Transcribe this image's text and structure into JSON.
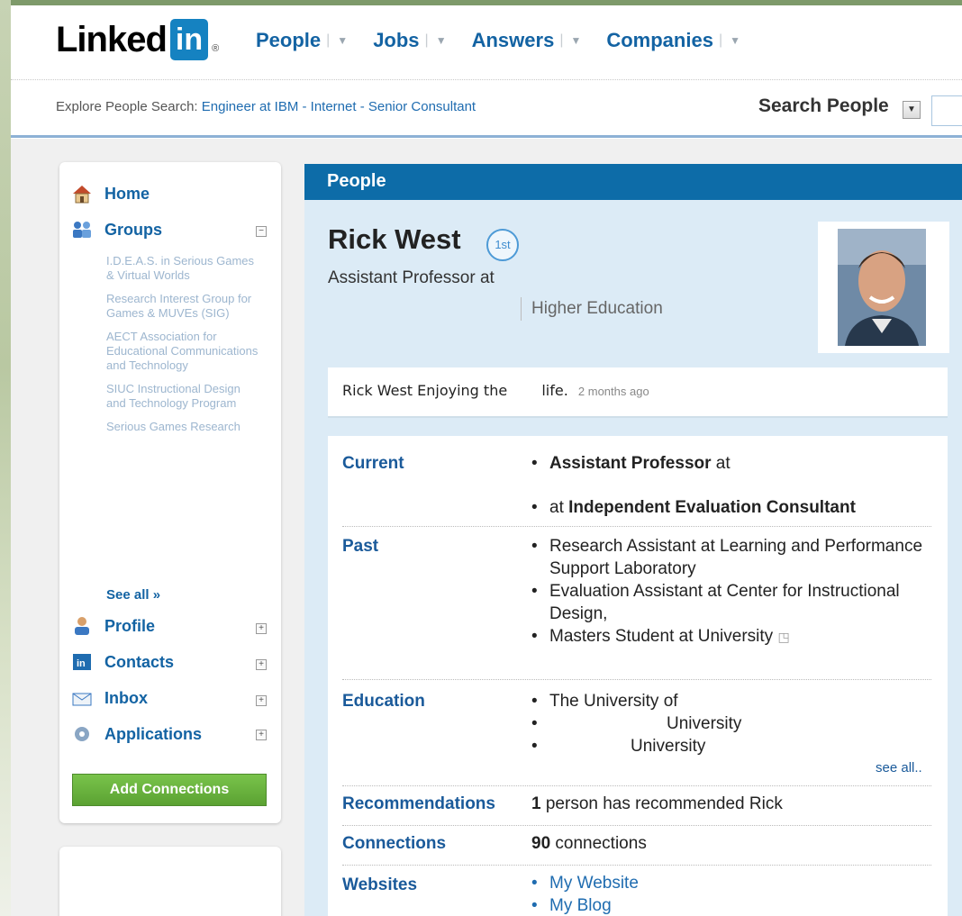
{
  "header": {
    "logo_text": "Linked",
    "logo_box": "in",
    "logo_reg": "®",
    "nav": [
      {
        "label": "People"
      },
      {
        "label": "Jobs"
      },
      {
        "label": "Answers"
      },
      {
        "label": "Companies"
      }
    ],
    "explore_prefix": "Explore People Search:",
    "explore_links": "Engineer at IBM - Internet - Senior Consultant",
    "search_label": "Search People",
    "search_select_glyph": "▼"
  },
  "sidebar": {
    "items": [
      {
        "label": "Home",
        "icon": "home-icon"
      },
      {
        "label": "Groups",
        "icon": "groups-icon",
        "toggle": "−"
      },
      {
        "label": "Profile",
        "icon": "profile-icon",
        "toggle": "+"
      },
      {
        "label": "Contacts",
        "icon": "contacts-icon",
        "toggle": "+"
      },
      {
        "label": "Inbox",
        "icon": "inbox-icon",
        "toggle": "+"
      },
      {
        "label": "Applications",
        "icon": "applications-icon",
        "toggle": "+"
      }
    ],
    "groups": [
      "I.D.E.A.S. in Serious Games & Virtual Worlds",
      "Research Interest Group for Games & MUVEs (SIG)",
      "AECT Association for Educational Communications and Technology",
      "SIUC Instructional Design and Technology Program",
      "Serious Games Research"
    ],
    "see_all": "See all »",
    "add_connections": "Add Connections"
  },
  "profile": {
    "section_title": "People",
    "name": "Rick West",
    "degree": "1st",
    "headline": "Assistant Professor at",
    "industry": "Higher Education",
    "status_text": "Rick West Enjoying the ",
    "status_text_end": " life.",
    "status_time": "2 months ago",
    "rows": {
      "current_label": "Current",
      "current_1_bold": "Assistant Professor",
      "current_1_rest": " at",
      "current_2_prefix": "at ",
      "current_2_bold": "Independent Evaluation Consultant",
      "past_label": "Past",
      "past": [
        "Research Assistant at Learning and Performance Support Laboratory",
        "Evaluation Assistant at Center for Instructional Design,",
        "Masters Student at University"
      ],
      "education_label": "Education",
      "education": [
        "The University of",
        "University",
        "University"
      ],
      "education_see_all": "see all..",
      "recommendations_label": "Recommendations",
      "recommendations_count": "1",
      "recommendations_text": " person has recommended Rick",
      "connections_label": "Connections",
      "connections_count": "90",
      "connections_text": " connections",
      "websites_label": "Websites",
      "websites": [
        "My Website",
        "My Blog"
      ]
    }
  },
  "colors": {
    "brand_blue": "#1582c1",
    "nav_blue": "#1363a3",
    "header_bar": "#0d6ca8",
    "profile_bg": "#dcebf6",
    "button_green": "#5ba232"
  }
}
